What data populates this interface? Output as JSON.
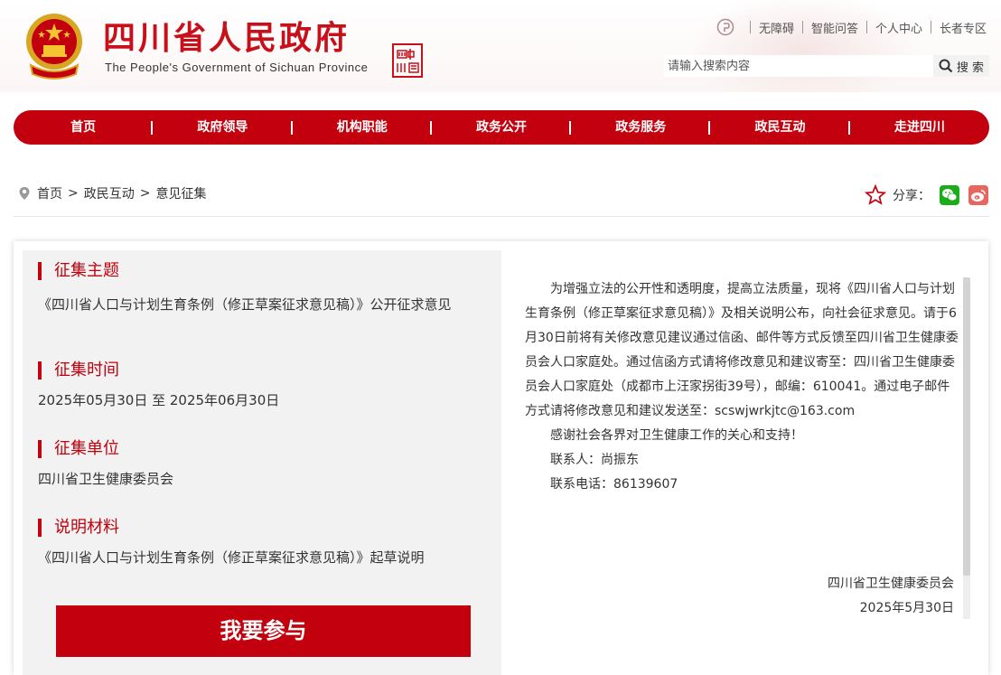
{
  "header": {
    "site_title": "四川省人民政府",
    "site_subtitle": "The People's Government of Sichuan Province",
    "seal_text": "四中川國",
    "top_links": [
      "无障碍",
      "智能问答",
      "个人中心",
      "长者专区"
    ],
    "search": {
      "placeholder": "请输入搜索内容",
      "button_label": "搜 索"
    }
  },
  "nav": [
    "首页",
    "政府领导",
    "机构职能",
    "政务公开",
    "政务服务",
    "政民互动",
    "走进四川"
  ],
  "breadcrumb": [
    "首页",
    "政民互动",
    "意见征集"
  ],
  "share": {
    "label": "分享：",
    "icons": [
      "wechat-icon",
      "weibo-icon"
    ]
  },
  "left": {
    "sections": [
      {
        "title": "征集主题",
        "text": "《四川省人口与计划生育条例（修正草案征求意见稿）》公开征求意见"
      },
      {
        "title": "征集时间",
        "text": "2025年05月30日 至 2025年06月30日"
      },
      {
        "title": "征集单位",
        "text": "四川省卫生健康委员会"
      },
      {
        "title": "说明材料",
        "text": "《四川省人口与计划生育条例（修正草案征求意见稿）》起草说明"
      }
    ],
    "cta_label": "我要参与"
  },
  "right": {
    "paragraphs": [
      "为增强立法的公开性和透明度，提高立法质量，现将《四川省人口与计划生育条例（修正草案征求意见稿）》及相关说明公布，向社会征求意见。请于6月30日前将有关修改意见建议通过信函、邮件等方式反馈至四川省卫生健康委员会人口家庭处。通过信函方式请将修改意见和建议寄至：四川省卫生健康委员会人口家庭处（成都市上汪家拐街39号），邮编：610041。通过电子邮件方式请将修改意见和建议发送至：scswjwrkjtc@163.com",
      "感谢社会各界对卫生健康工作的关心和支持！",
      "联系人：尚振东",
      "联系电话：86139607"
    ],
    "signature_org": "四川省卫生健康委员会",
    "signature_date": "2025年5月30日"
  },
  "colors": {
    "primary_red": "#c3000d",
    "nav_text": "#ffffff",
    "panel_bg": "#f2f2f2"
  }
}
